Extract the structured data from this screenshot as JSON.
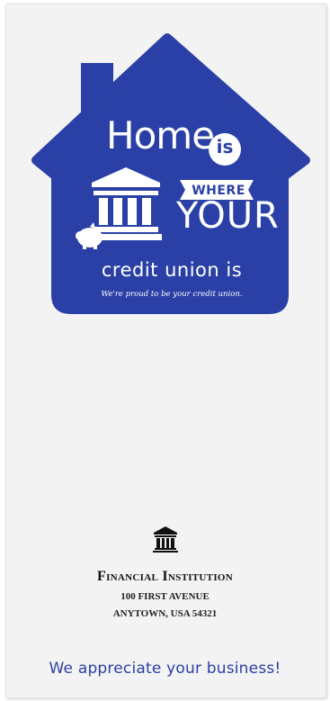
{
  "colors": {
    "brand_blue": "#2a40a6",
    "card": "#f3f3f3",
    "ink": "#111111"
  },
  "headline": {
    "home": "Home",
    "is": "is",
    "where": "WHERE",
    "your": "YOUR",
    "credit_line": "credit union is",
    "tagline": "We're proud to be your credit union."
  },
  "institution": {
    "icon": "bank-building-icon",
    "name": "Financial Institution",
    "address_line1": "100 FIRST AVENUE",
    "address_line2": "ANYTOWN, USA 54321"
  },
  "footer": {
    "thanks": "We appreciate your business!"
  }
}
